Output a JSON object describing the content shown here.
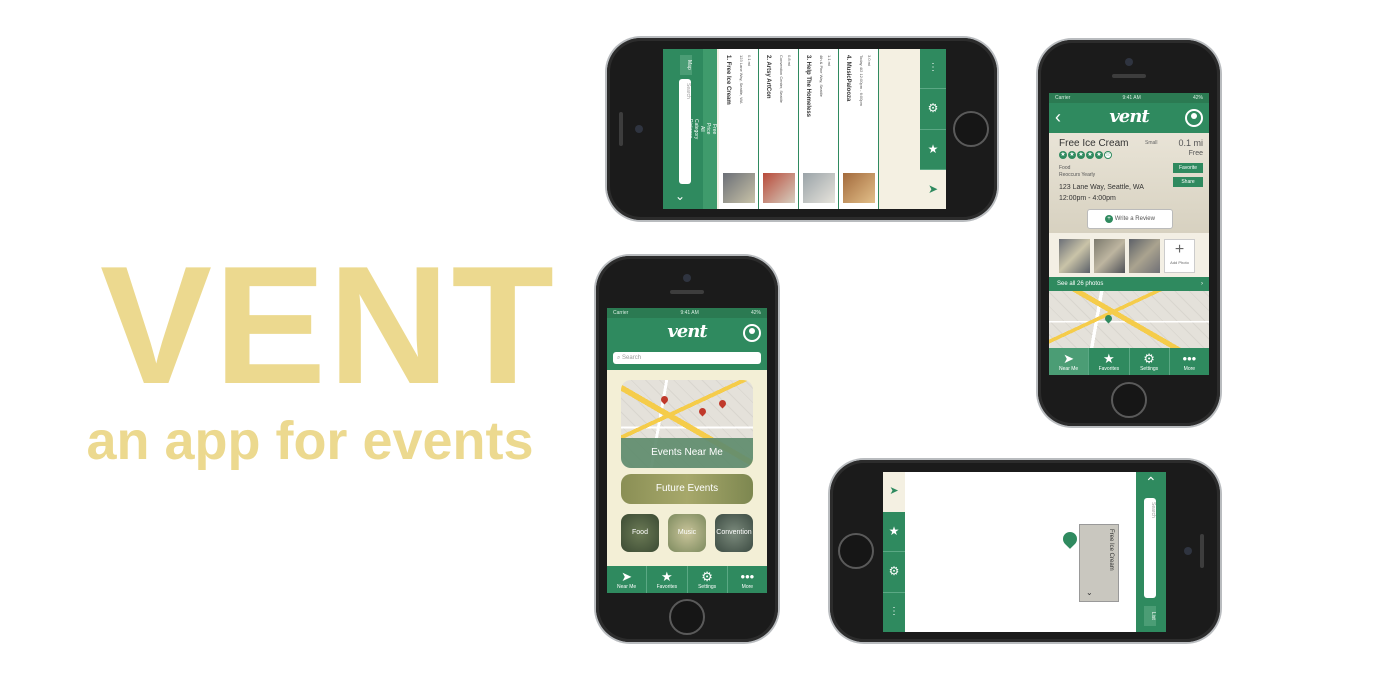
{
  "hero": {
    "title": "VENT",
    "subtitle": "an app for events"
  },
  "colors": {
    "accent": "#2f8a5f",
    "hero": "#ecd98f"
  },
  "status": {
    "carrier": "Carrier",
    "time": "9:41 AM",
    "battery": "42%"
  },
  "logo": "vent",
  "tabs": [
    {
      "label": "Near Me",
      "icon": "navigation-icon"
    },
    {
      "label": "Favorites",
      "icon": "star-icon"
    },
    {
      "label": "Settings",
      "icon": "gear-icon"
    },
    {
      "label": "More",
      "icon": "more-icon"
    }
  ],
  "home": {
    "search_placeholder": "Search",
    "near_me": "Events Near Me",
    "future": "Future Events",
    "categories": [
      "Food",
      "Music",
      "Convention"
    ]
  },
  "detail": {
    "title": "Free Ice Cream",
    "size": "Small",
    "distance": "0.1 mi",
    "price": "Free",
    "category": "Food",
    "recurrence": "Reoccurs Yearly",
    "address": "123 Lane Way, Seattle, WA",
    "time": "12:00pm - 4:00pm",
    "favorite": "Favorite",
    "share": "Share",
    "review": "Write a Review",
    "add_photo": "Add Photo",
    "see_all": "See all 26 photos"
  },
  "list": {
    "sort_by": "Sort by",
    "sort_options": [
      "Distance",
      "Category",
      "All",
      "Price",
      "Free"
    ],
    "map": "Map",
    "search_placeholder": "Search",
    "items": [
      {
        "title": "1. Free Ice Cream",
        "size": "Small",
        "distance": "0.1 mi",
        "price": "Free",
        "category": "Food",
        "address": "123 Lane Way, Seattle, WA",
        "time": "12:00pm - 4:00pm"
      },
      {
        "title": "2. Artsy ArtCon",
        "size": "Large",
        "distance": "0.8 mi",
        "price": "Free",
        "category": "Convention",
        "address": "Convention Center, Seattle",
        "time": "8:00am - 6:00pm"
      },
      {
        "title": "3. Help The Homeless",
        "size": "Large",
        "distance": "1.1 mi",
        "price": "Free",
        "category": "Other",
        "address": "4th & Pine Way, Seattle",
        "time": "7:00pm - 11:00pm"
      },
      {
        "title": "4. MusicPalooza",
        "size": "Large",
        "distance": "3.0 mi",
        "price": "Free",
        "category": "Music",
        "address": "Today 4/2  12:00pm - 6:00pm",
        "time": ""
      }
    ]
  },
  "map_view": {
    "search_placeholder": "Search",
    "list": "List",
    "pin_title": "Free Ice Cream"
  }
}
